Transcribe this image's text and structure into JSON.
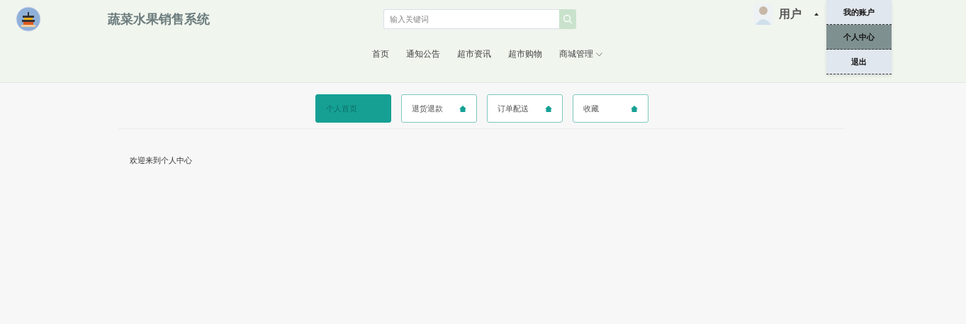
{
  "header": {
    "title": "蔬菜水果销售系统",
    "search": {
      "placeholder": "输入关键词"
    },
    "user": {
      "name": "用户",
      "menu_expanded": true
    }
  },
  "nav": [
    {
      "label": "首页",
      "has_submenu": false
    },
    {
      "label": "通知公告",
      "has_submenu": false
    },
    {
      "label": "超市资讯",
      "has_submenu": false
    },
    {
      "label": "超市购物",
      "has_submenu": false
    },
    {
      "label": "商城管理",
      "has_submenu": true
    }
  ],
  "user_menu": [
    {
      "label": "我的账户",
      "selected": false
    },
    {
      "label": "个人中心",
      "selected": true
    },
    {
      "label": "退出",
      "selected": false
    }
  ],
  "tabs": [
    {
      "label": "个人首页",
      "selected": true
    },
    {
      "label": "退货退款",
      "selected": false
    },
    {
      "label": "订单配送",
      "selected": false
    },
    {
      "label": "收藏",
      "selected": false
    }
  ],
  "content": {
    "text": "欢迎来到个人中心"
  }
}
